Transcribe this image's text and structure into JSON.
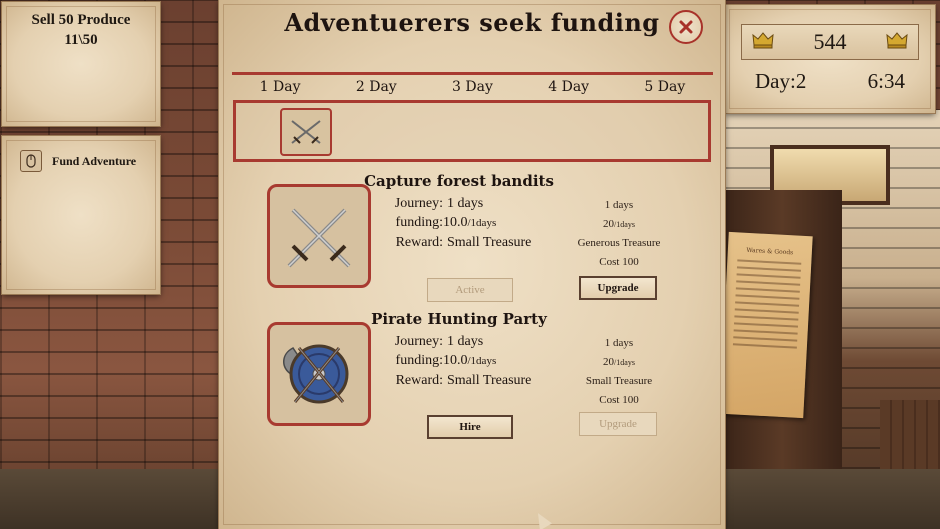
{
  "quest": {
    "title": "Sell 50 Produce",
    "progress": "11\\50"
  },
  "tasks": [
    {
      "label": "Fund Adventure",
      "icon": "mouse-icon"
    }
  ],
  "stats": {
    "gold": "544",
    "day_label": "Day:2",
    "time": "6:34",
    "icon": "crown-icon"
  },
  "dialog": {
    "title": "Adventuerers seek funding",
    "day_tabs": [
      "1 Day",
      "2 Day",
      "3 Day",
      "4 Day",
      "5 Day"
    ],
    "timeline_icon": "crossed-swords-icon"
  },
  "missions": [
    {
      "title": "Capture forest bandits",
      "icon": "crossed-swords-icon",
      "journey_label": "Journey:",
      "journey_value": "1  days",
      "funding_label": "funding:",
      "funding_value": "10.0",
      "funding_unit": "/1days",
      "reward_label": "Reward:",
      "reward_value": "Small Treasure",
      "upgrade_journey": "1 days",
      "upgrade_funding": "20",
      "upgrade_funding_unit": "/1days",
      "upgrade_reward": "Generous Treasure",
      "upgrade_cost": "Cost 100",
      "primary_button": "Active",
      "upgrade_button": "Upgrade"
    },
    {
      "title": "Pirate Hunting Party",
      "icon": "shield-axes-icon",
      "journey_label": "Journey:",
      "journey_value": "1  days",
      "funding_label": "funding:",
      "funding_value": "10.0",
      "funding_unit": "/1days",
      "reward_label": "Reward:",
      "reward_value": "Small Treasure",
      "upgrade_journey": "1 days",
      "upgrade_funding": "20",
      "upgrade_funding_unit": "/1days",
      "upgrade_reward": "Small Treasure",
      "upgrade_cost": "Cost 100",
      "primary_button": "Hire",
      "upgrade_button": "Upgrade"
    }
  ],
  "notice": {
    "title": "Wares & Goods"
  },
  "colors": {
    "accent_red": "#a83a30",
    "parchment": "#e4d0b0",
    "ink": "#1e1410"
  }
}
